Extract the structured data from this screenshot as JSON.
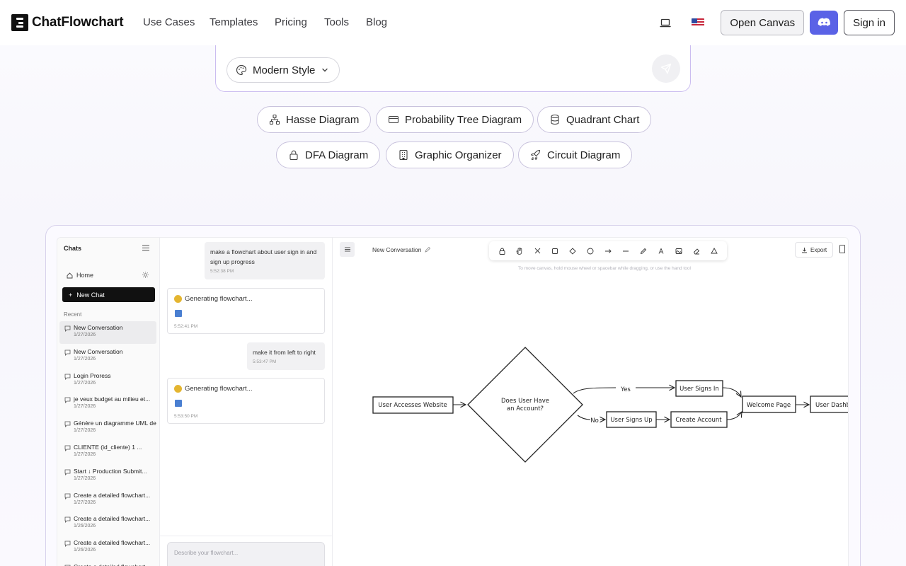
{
  "brand": {
    "name": "ChatFlowchart"
  },
  "nav": {
    "links": [
      "Use Cases",
      "Templates",
      "Pricing",
      "Tools",
      "Blog"
    ],
    "open_canvas": "Open Canvas",
    "sign_in": "Sign in",
    "icons": {
      "device": "laptop-icon",
      "language": "us-flag-icon",
      "community": "discord-icon"
    }
  },
  "prompt": {
    "style_label": "Modern Style",
    "send_icon": "send-icon"
  },
  "chips": {
    "row1": [
      "Hasse Diagram",
      "Probability Tree Diagram",
      "Quadrant Chart"
    ],
    "row2": [
      "DFA Diagram",
      "Graphic Organizer",
      "Circuit Diagram"
    ]
  },
  "preview": {
    "sidebar": {
      "title": "Chats",
      "home": "Home",
      "new_chat": "New Chat",
      "recent_label": "Recent",
      "conversations": [
        {
          "title": "New Conversation",
          "date": "1/27/2026"
        },
        {
          "title": "New Conversation",
          "date": "1/27/2026"
        },
        {
          "title": "Login Proress",
          "date": "1/27/2026"
        },
        {
          "title": "je veux budget au milieu et...",
          "date": "1/27/2026"
        },
        {
          "title": "Génère un diagramme UML de",
          "date": "1/27/2026"
        },
        {
          "title": "CLIENTE (id_cliente) 1 ...",
          "date": "1/27/2026"
        },
        {
          "title": "Start ↓ Production Submit...",
          "date": "1/27/2026"
        },
        {
          "title": "Create a detailed flowchart...",
          "date": "1/27/2026"
        },
        {
          "title": "Create a detailed flowchart...",
          "date": "1/26/2026"
        },
        {
          "title": "Create a detailed flowchart...",
          "date": "1/26/2026"
        },
        {
          "title": "Create a detailed flowchart...",
          "date": ""
        }
      ]
    },
    "chat": {
      "messages": [
        {
          "role": "user",
          "text": "make a flowchart about user sign in and sign up progress",
          "time": "5:52:38 PM"
        },
        {
          "role": "assistant",
          "text": "Generating flowchart...",
          "time": "5:52:41 PM"
        },
        {
          "role": "user",
          "text": "make it from left to right",
          "time": "5:53:47 PM"
        },
        {
          "role": "assistant",
          "text": "Generating flowchart...",
          "time": "5:53:50 PM"
        }
      ],
      "input_placeholder": "Describe your flowchart..."
    },
    "canvas": {
      "title": "New Conversation",
      "hint": "To move canvas, hold mouse wheel or spacebar while dragging, or use the hand tool",
      "export_label": "Export",
      "tools": [
        "lock-icon",
        "hand-icon",
        "selection-icon",
        "rectangle-icon",
        "diamond-icon",
        "ellipse-icon",
        "arrow-icon",
        "line-icon",
        "pencil-icon",
        "text-icon",
        "image-icon",
        "eraser-icon",
        "shapes-icon"
      ],
      "flow": {
        "start": "User Accesses Website",
        "decision_line1": "Does User Have",
        "decision_line2": "an Account?",
        "yes_label": "Yes",
        "no_label": "No",
        "sign_in": "User Signs In",
        "sign_up": "User Signs Up",
        "create": "Create Account",
        "welcome": "Welcome Page",
        "dashboard": "User Dashb"
      }
    }
  }
}
